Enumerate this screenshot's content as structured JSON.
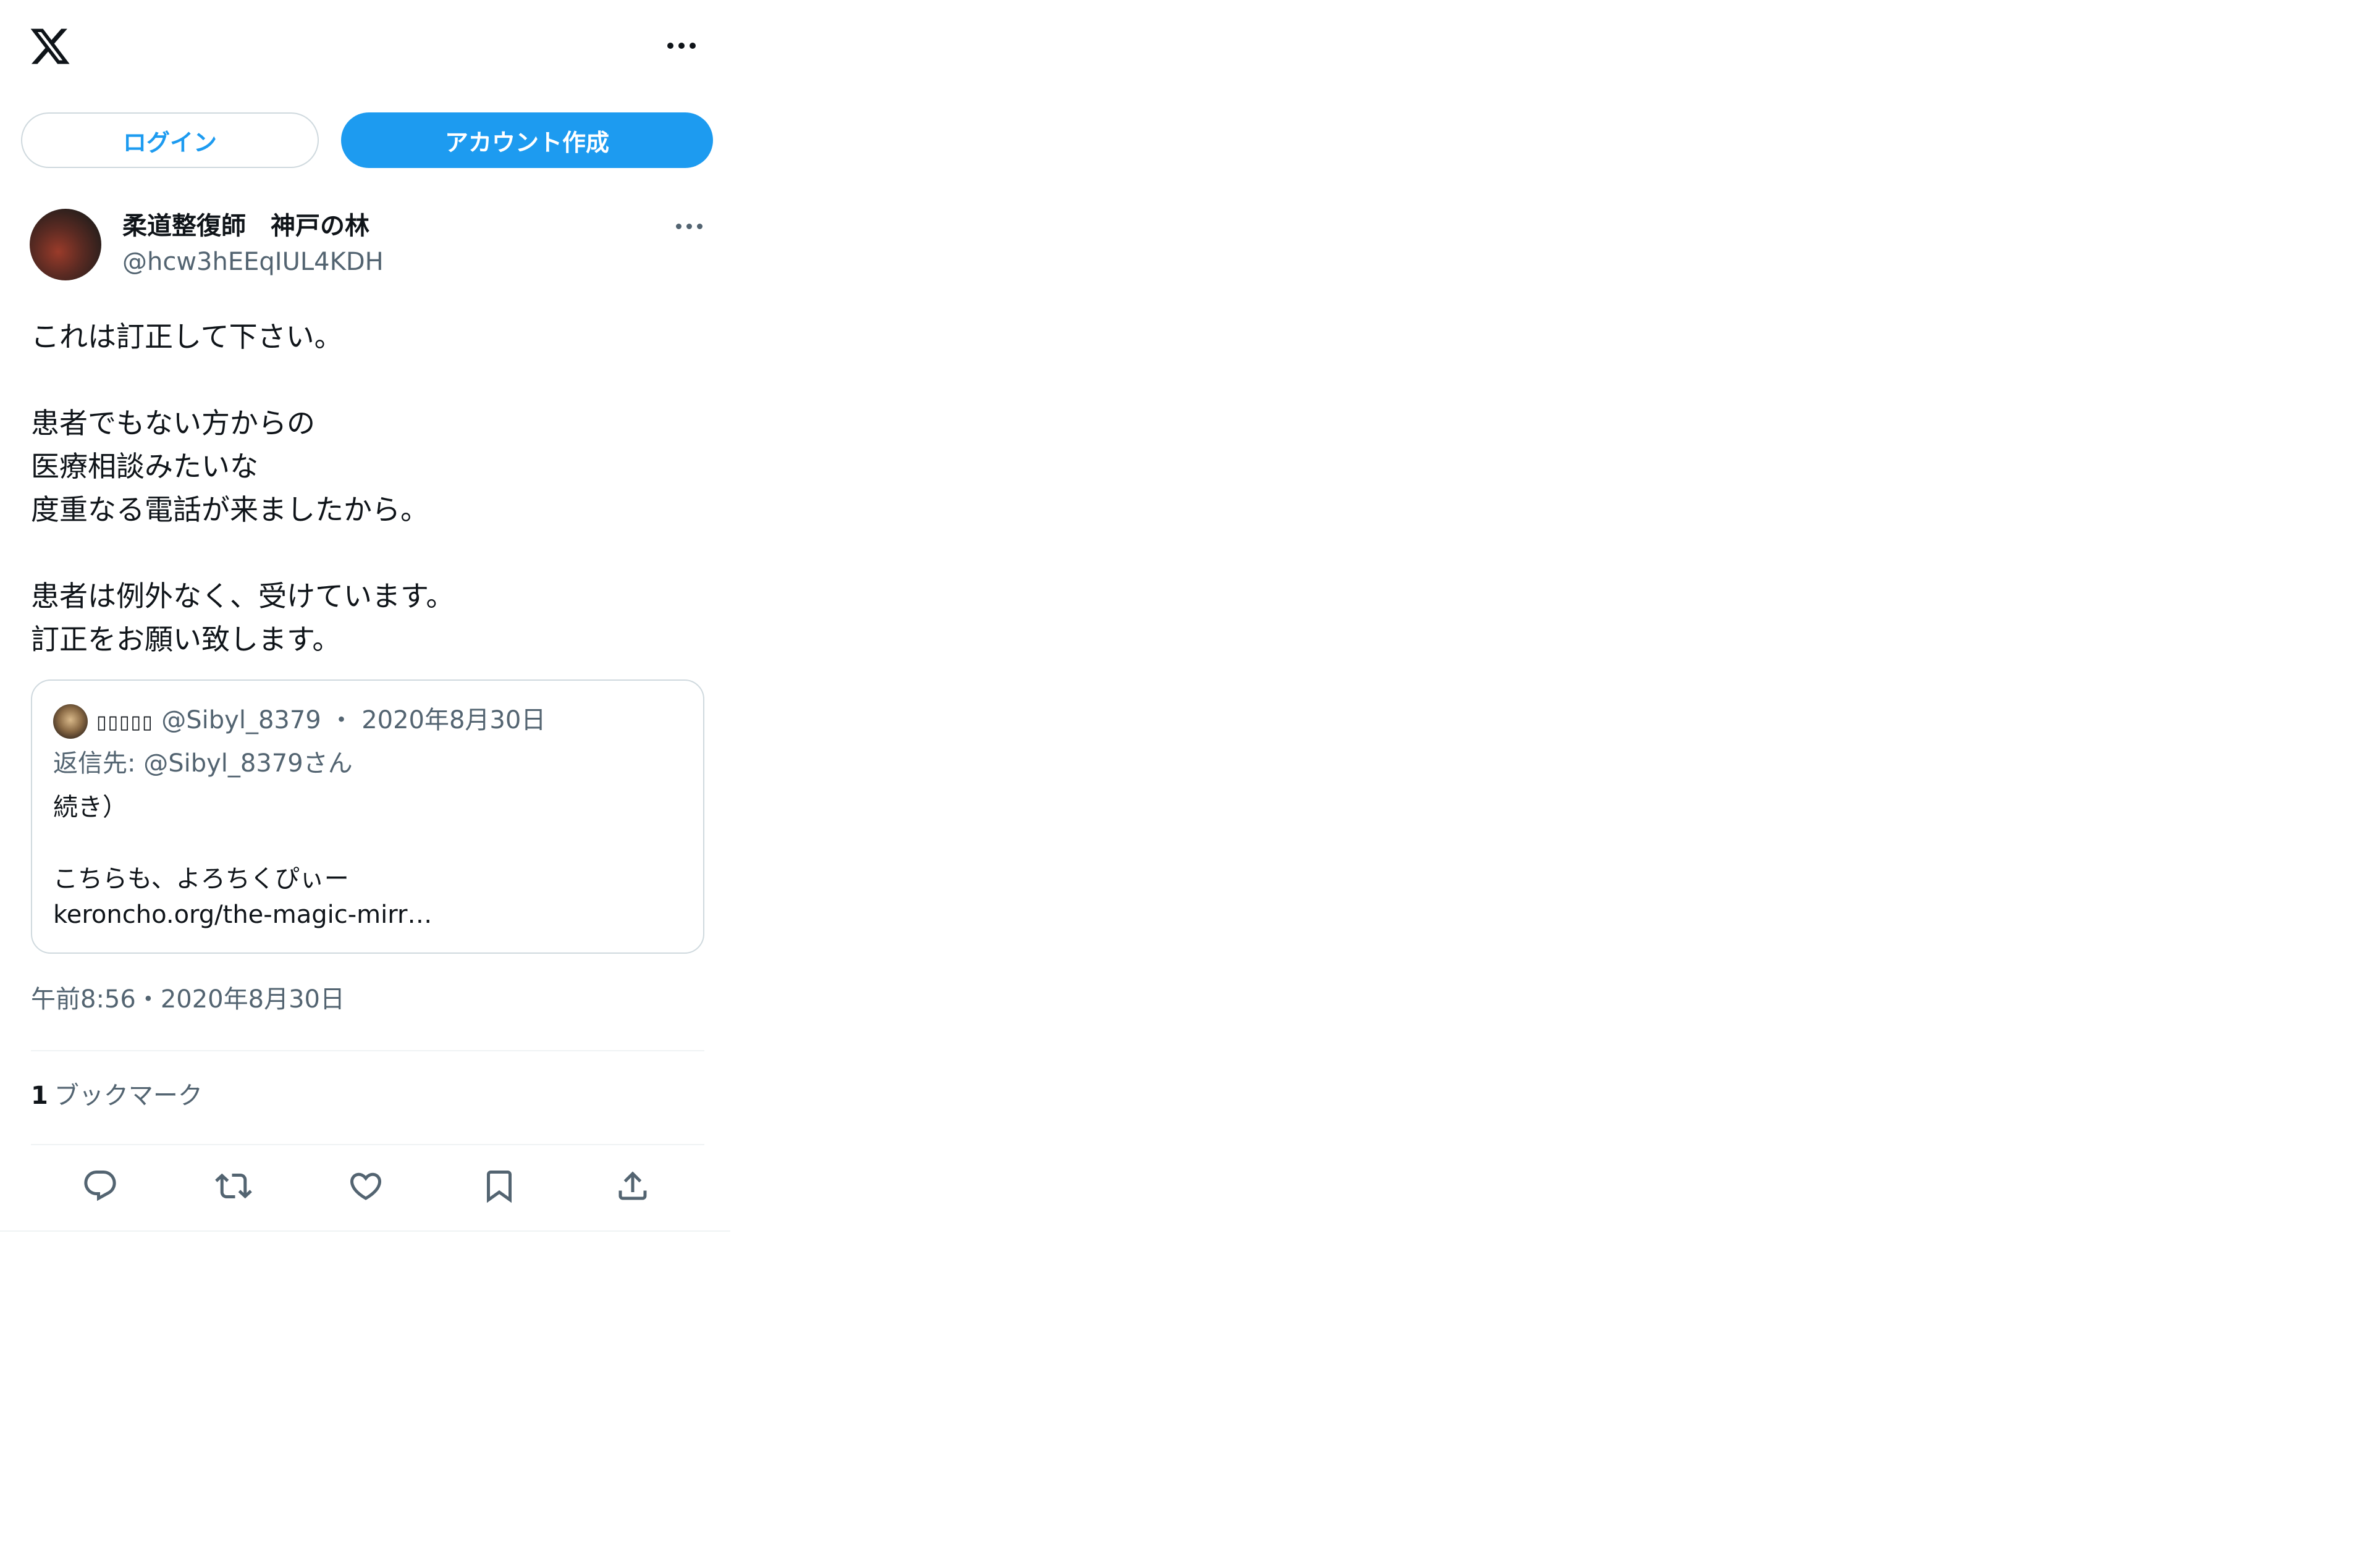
{
  "topbar": {
    "logo_icon": "x-logo-icon",
    "more_icon": "more-icon"
  },
  "buttons": {
    "login": "ログイン",
    "signup": "アカウント作成",
    "accent": "#1d9bf0"
  },
  "tweet": {
    "author_name": "柔道整復師　神戸の林",
    "author_handle": "@hcw3hEEqIUL4KDH",
    "text_lines": [
      "これは訂正して下さい。",
      "",
      "患者でもない方からの",
      "医療相談みたいな",
      "度重なる電話が来ましたから。",
      "",
      "患者は例外なく、受けています。",
      "訂正をお願い致します。"
    ],
    "timestamp": "午前8:56・2020年8月30日",
    "bookmark_count": "1",
    "bookmark_label": "ブックマーク"
  },
  "quote": {
    "name": "▯▯▯▯▯",
    "handle": "@Sibyl_8379",
    "separator": "・",
    "date": "2020年8月30日",
    "reply_to": "返信先: @Sibyl_8379さん",
    "text_lines": [
      "続き）",
      "",
      "こちらも、よろちくぴぃー",
      "keroncho.org/the-magic-mirr…"
    ]
  },
  "actions": [
    "reply-icon",
    "retweet-icon",
    "like-icon",
    "bookmark-icon",
    "share-icon"
  ]
}
